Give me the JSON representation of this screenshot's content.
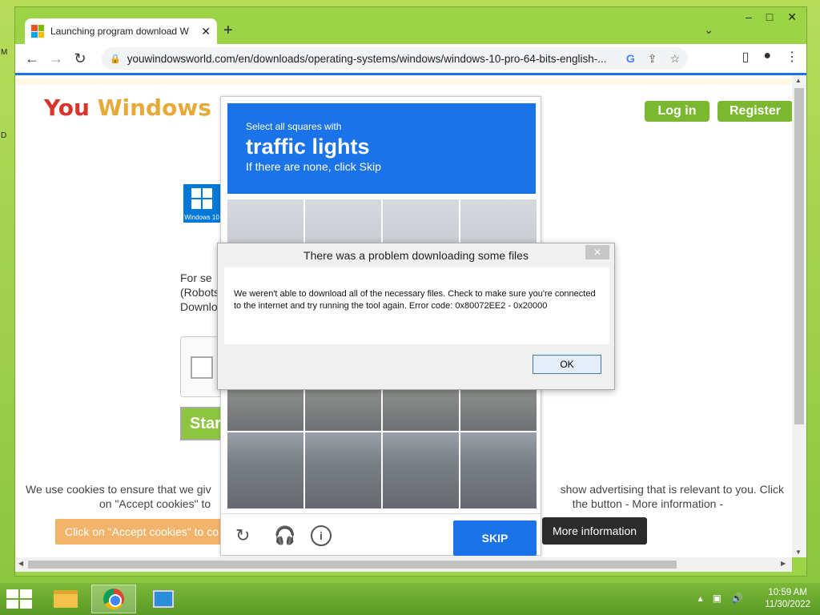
{
  "browser": {
    "tab_title": "Launching program download W",
    "url": "youwindowsworld.com/en/downloads/operating-systems/windows/windows-10-pro-64-bits-english-...",
    "window_controls": [
      "–",
      "□",
      "✕"
    ]
  },
  "site": {
    "logo_part1": "You",
    "logo_part2": "Windows",
    "login_label": "Log in",
    "register_label": "Register",
    "win10_label": "Windows 10",
    "para_line1": "For se",
    "para_line2": "(Robots",
    "para_line3": "Downlo",
    "start_label": "Star",
    "cookie_line1": "We use cookies to ensure that we giv",
    "cookie_line1_right": "show advertising that is relevant to you. Click",
    "cookie_line2": "on \"Accept cookies\" to",
    "cookie_line2_right": "the button - More information -",
    "accept_label": "Click on \"Accept cookies\" to co",
    "more_info_label": "More information"
  },
  "captcha": {
    "line1": "Select all squares with",
    "line2": "traffic lights",
    "line3": "If there are none, click Skip",
    "skip_label": "SKIP",
    "icons": [
      "refresh-icon",
      "headphones-icon",
      "info-icon"
    ]
  },
  "dialog": {
    "title": "There was a problem downloading some files",
    "message": "We weren't able to download all of the necessary files. Check to make sure you're connected to the internet and try running the tool again. Error code: 0x80072EE2 - 0x20000",
    "ok_label": "OK",
    "close_label": "✕"
  },
  "taskbar": {
    "time": "10:59 AM",
    "date": "11/30/2022"
  },
  "desktop": {
    "letter1": "M",
    "letter2": "D"
  }
}
